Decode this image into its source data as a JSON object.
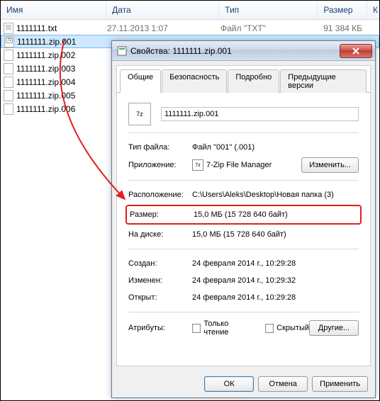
{
  "explorer": {
    "headers": {
      "name": "Имя",
      "date": "Дата",
      "type": "Тип",
      "size": "Размер",
      "last": "К"
    },
    "files": [
      {
        "name": "1111111.txt",
        "date": "27.11.2013 1:07",
        "type": "Файл \"TXT\"",
        "size": "91 384 КБ",
        "icon": "txt",
        "selected": false
      },
      {
        "name": "1111111.zip.001",
        "date": "",
        "type": "",
        "size": "",
        "icon": "zip-sel",
        "selected": true
      },
      {
        "name": "1111111.zip.002",
        "date": "",
        "type": "",
        "size": "",
        "icon": "zip",
        "selected": false
      },
      {
        "name": "1111111.zip.003",
        "date": "",
        "type": "",
        "size": "",
        "icon": "zip",
        "selected": false
      },
      {
        "name": "1111111.zip.004",
        "date": "",
        "type": "",
        "size": "",
        "icon": "zip",
        "selected": false
      },
      {
        "name": "1111111.zip.005",
        "date": "",
        "type": "",
        "size": "",
        "icon": "zip",
        "selected": false
      },
      {
        "name": "1111111.zip.006",
        "date": "",
        "type": "",
        "size": "",
        "icon": "zip",
        "selected": false
      }
    ]
  },
  "dialog": {
    "title": "Свойства: 1111111.zip.001",
    "tabs": [
      "Общие",
      "Безопасность",
      "Подробно",
      "Предыдущие версии"
    ],
    "activeTab": 0,
    "icon_label": "7z",
    "filename": "1111111.zip.001",
    "rows": {
      "type_label": "Тип файла:",
      "type_value": "Файл \"001\" (.001)",
      "app_label": "Приложение:",
      "app_value": "7-Zip File Manager",
      "change_btn": "Изменить...",
      "loc_label": "Расположение:",
      "loc_value": "C:\\Users\\Aleks\\Desktop\\Новая папка (3)",
      "size_label": "Размер:",
      "size_value": "15,0 МБ (15 728 640 байт)",
      "ondisk_label": "На диске:",
      "ondisk_value": "15,0 МБ (15 728 640 байт)",
      "created_label": "Создан:",
      "created_value": "24 февраля 2014 г., 10:29:28",
      "modified_label": "Изменен:",
      "modified_value": "24 февраля 2014 г., 10:29:32",
      "accessed_label": "Открыт:",
      "accessed_value": "24 февраля 2014 г., 10:29:28",
      "attr_label": "Атрибуты:",
      "readonly": "Только чтение",
      "hidden": "Скрытый",
      "other_btn": "Другие..."
    },
    "buttons": {
      "ok": "ОК",
      "cancel": "Отмена",
      "apply": "Применить"
    }
  }
}
